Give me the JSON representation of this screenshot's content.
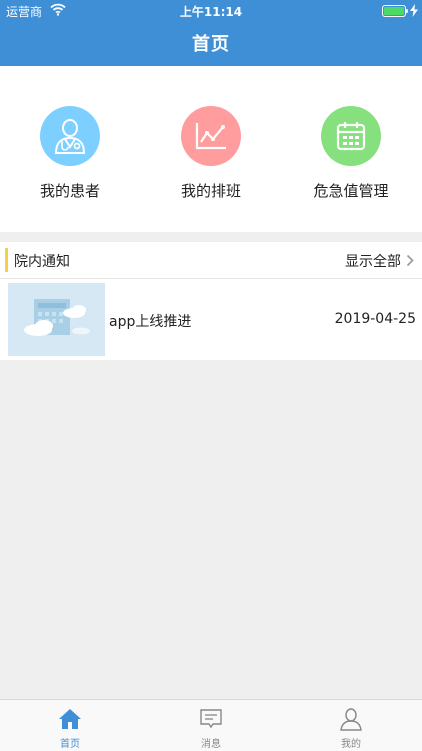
{
  "status_bar": {
    "carrier": "运营商",
    "time": "上午11:14"
  },
  "header": {
    "title": "首页"
  },
  "shortcuts": [
    {
      "label": "我的患者",
      "icon": "doctor-icon",
      "color": "#7ccfff"
    },
    {
      "label": "我的排班",
      "icon": "line-chart-icon",
      "color": "#ff9c9d"
    },
    {
      "label": "危急值管理",
      "icon": "calendar-icon",
      "color": "#85e07d"
    }
  ],
  "notices": {
    "title": "院内通知",
    "show_all": "显示全部",
    "items": [
      {
        "title": "app上线推进",
        "date": "2019-04-25",
        "thumbnail": "cloud-building-illustration"
      }
    ]
  },
  "tabbar": {
    "items": [
      {
        "label": "首页",
        "icon": "home-icon",
        "active": true
      },
      {
        "label": "消息",
        "icon": "message-icon",
        "active": false
      },
      {
        "label": "我的",
        "icon": "person-icon",
        "active": false
      }
    ]
  },
  "colors": {
    "primary": "#3f8fd7",
    "accent_bar": "#f2d04a",
    "tab_inactive": "#888888"
  }
}
